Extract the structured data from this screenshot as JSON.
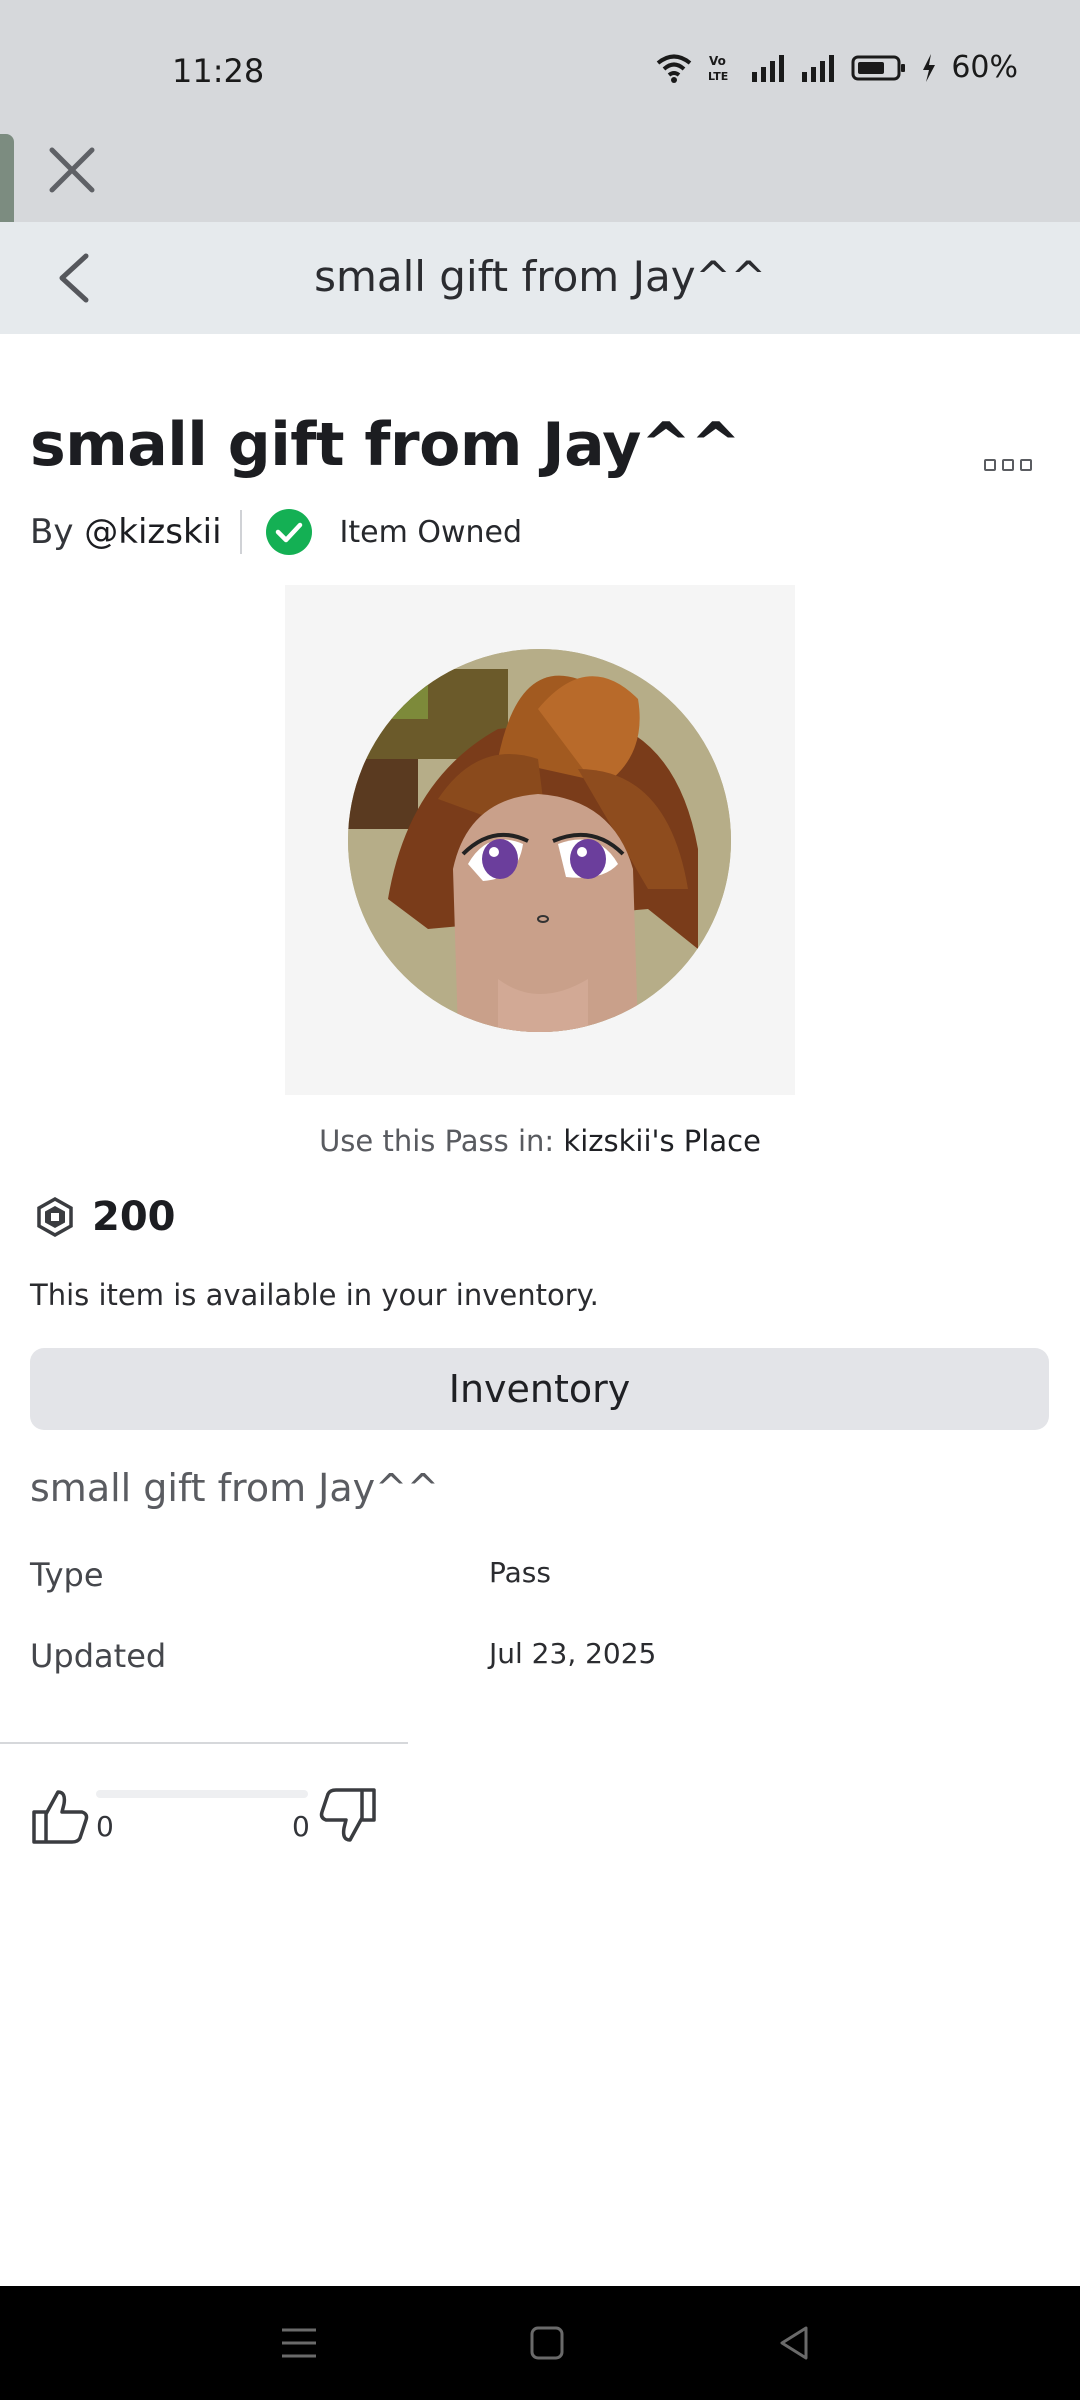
{
  "status_bar": {
    "time": "11:28",
    "battery": "60%",
    "icons": [
      "wifi-icon",
      "volte-icon",
      "signal-icon",
      "signal-icon",
      "battery-icon",
      "charging-icon"
    ]
  },
  "header": {
    "title": "small gift from Jay^^"
  },
  "item": {
    "title": "small gift from Jay^^",
    "by_prefix": "By",
    "creator": "@kizskii",
    "owned_label": "Item Owned",
    "use_pass_prefix": "Use this Pass in:",
    "place_name": "kizskii's Place",
    "price": "200",
    "availability_text": "This item is available in your inventory.",
    "inventory_button": "Inventory",
    "description": "small gift from Jay^^",
    "details": [
      {
        "label": "Type",
        "value": "Pass"
      },
      {
        "label": "Updated",
        "value": "Jul 23, 2025"
      }
    ],
    "votes": {
      "up": "0",
      "down": "0"
    }
  },
  "colors": {
    "owned_check": "#14b054",
    "header_bg": "#e6eaed",
    "chrome_bg": "#d6d8db",
    "button_bg": "#e3e4e8"
  }
}
